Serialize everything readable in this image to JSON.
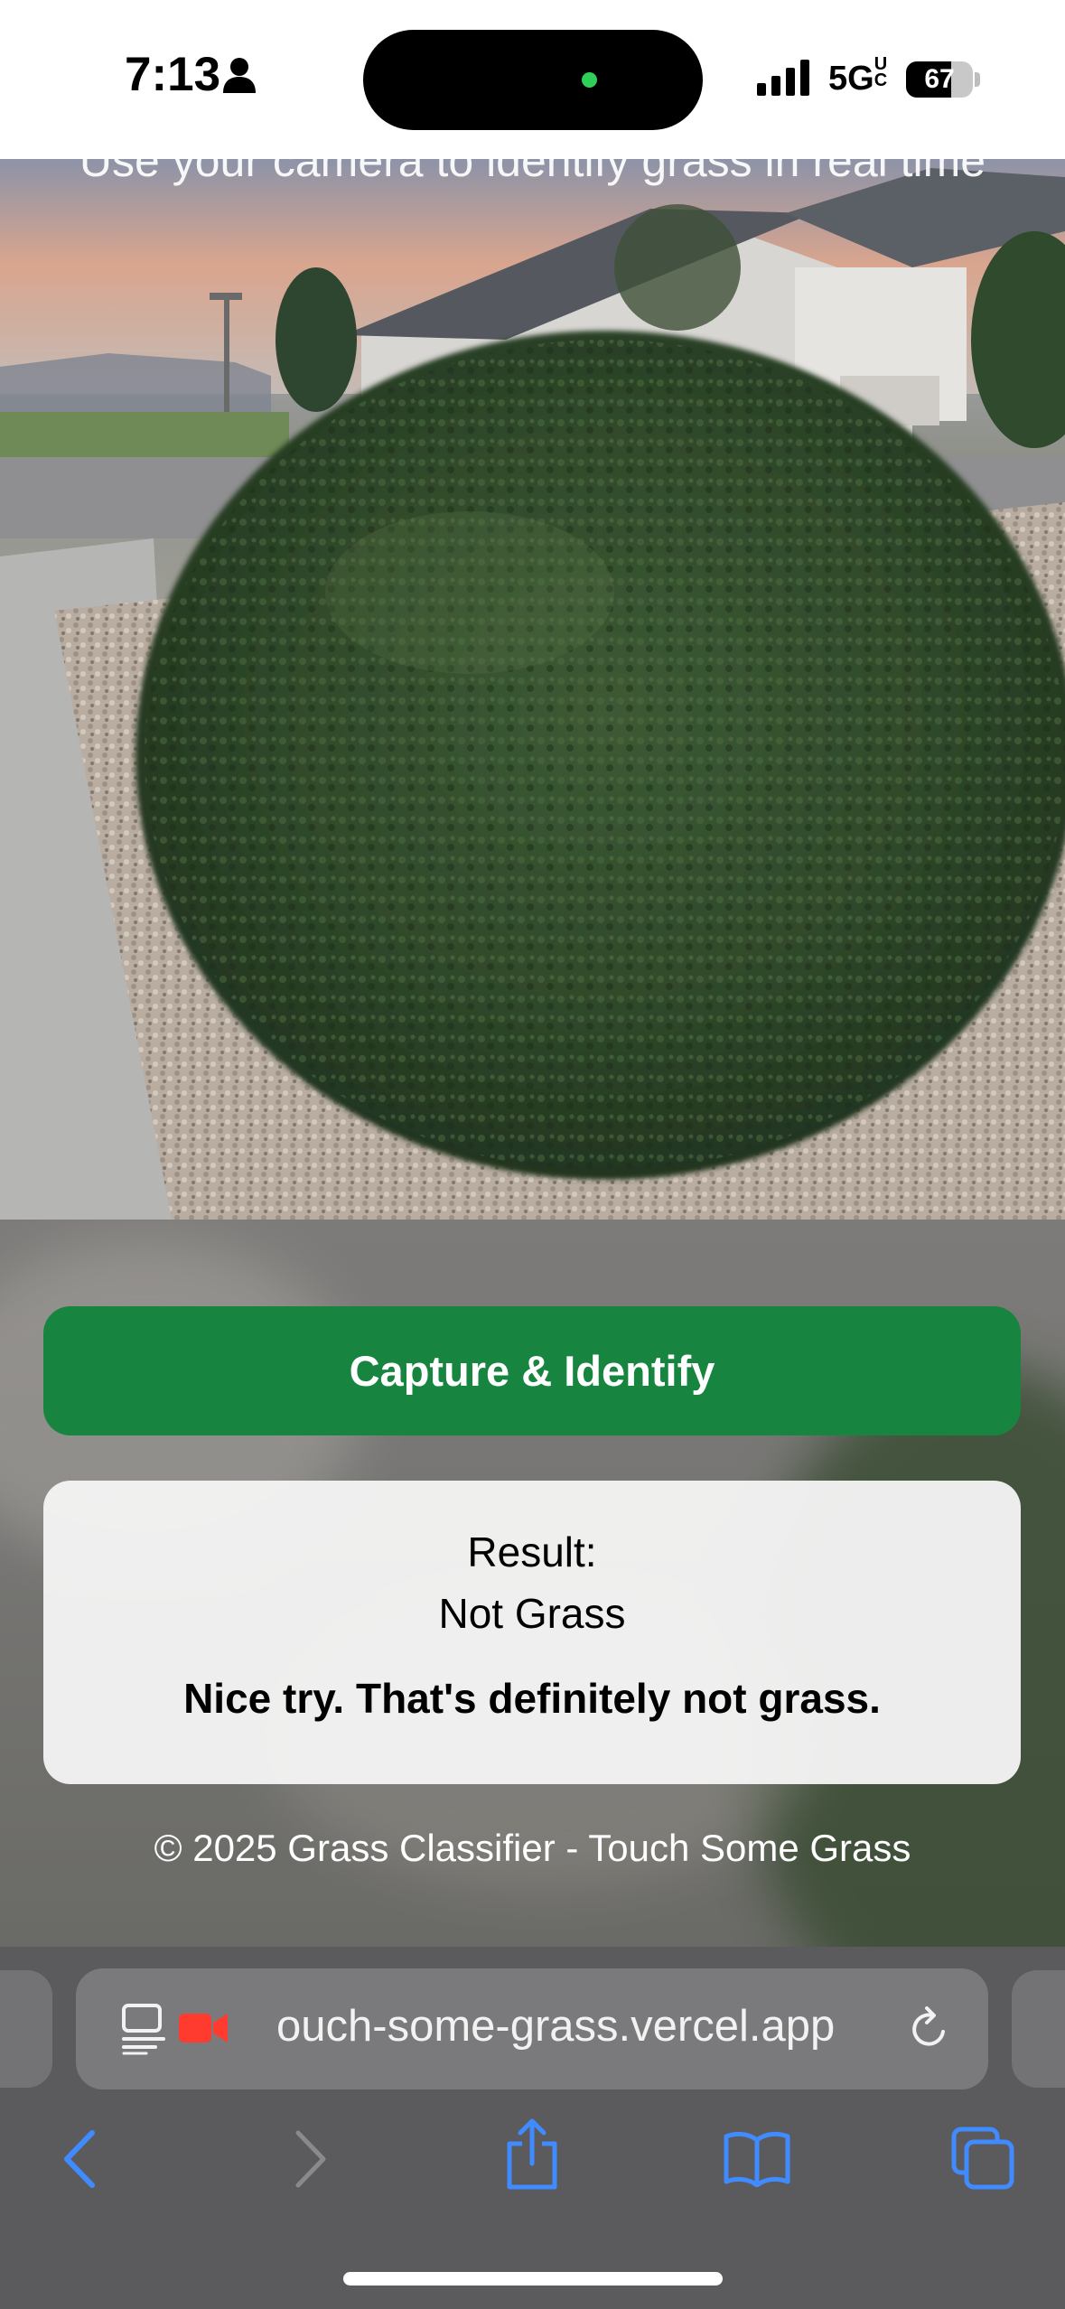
{
  "status_bar": {
    "time": "7:13",
    "network": "5G",
    "network_suffix": "UC",
    "battery": "67",
    "battery_level": 0.67
  },
  "camera": {
    "instruction": "Use your camera to identify grass in real time"
  },
  "capture_button": {
    "label": "Capture & Identify"
  },
  "result": {
    "label": "Result:",
    "value": "Not Grass",
    "message": "Nice try. That's definitely not grass."
  },
  "footer": {
    "text": "© 2025 Grass Classifier - Touch Some Grass"
  },
  "browser": {
    "url_display": "ouch-some-grass.vercel.app",
    "icons": [
      "reader-icon",
      "camera-recording-icon",
      "reload-icon",
      "back-icon",
      "forward-icon",
      "share-icon",
      "bookmarks-icon",
      "tabs-icon"
    ]
  },
  "colors": {
    "accent_button": "#17843f",
    "safari_blue": "#3f8bff",
    "recording_red": "#ff3b30"
  }
}
